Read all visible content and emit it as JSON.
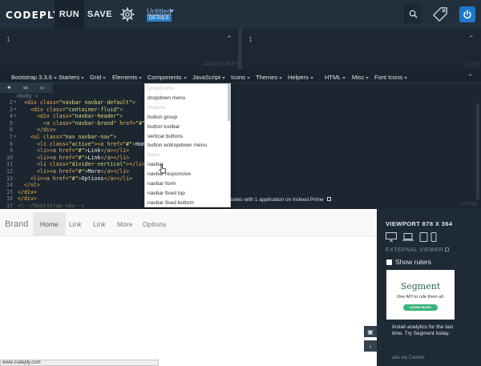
{
  "app": {
    "logo": "CODEPLY",
    "run_label": "RUN",
    "save_label": "SAVE",
    "project_title": "Untitled",
    "details_label": "DETAILS"
  },
  "editors": {
    "js": {
      "line_number": "1",
      "label": "JAVASCRIPT"
    },
    "css": {
      "line_number": "1",
      "label": "CSS"
    },
    "html": {
      "label": "HTML"
    }
  },
  "menubar": {
    "items": [
      {
        "label": "Bootstrap 3.3.6"
      },
      {
        "label": "Starters"
      },
      {
        "label": "Grid"
      },
      {
        "label": "Elements"
      },
      {
        "label": "Components"
      },
      {
        "label": "JavaScript"
      },
      {
        "label": "Icons"
      },
      {
        "label": "Themes"
      },
      {
        "label": "Helpers"
      },
      {
        "label": "HTML"
      },
      {
        "label": "Misc"
      },
      {
        "label": "Font Icons"
      }
    ]
  },
  "code": {
    "body_tag": "<body >",
    "lines": [
      {
        "n": "2",
        "fold": "▾",
        "segments": [
          [
            "tag",
            "<div class="
          ],
          [
            "str",
            "\"navbar navbar-default\""
          ],
          [
            "tag",
            ">"
          ]
        ]
      },
      {
        "n": "3",
        "fold": "▾",
        "segments": [
          [
            "tag",
            "<div class="
          ],
          [
            "str",
            "\"container-fluid\""
          ],
          [
            "tag",
            ">"
          ]
        ]
      },
      {
        "n": "4",
        "fold": "▾",
        "segments": [
          [
            "tag",
            "<div class="
          ],
          [
            "str",
            "\"navbar-header\""
          ],
          [
            "tag",
            ">"
          ]
        ]
      },
      {
        "n": "5",
        "fold": "",
        "segments": [
          [
            "tag",
            "<a class="
          ],
          [
            "str",
            "\"navbar-brand\""
          ],
          [
            "tag",
            " href="
          ],
          [
            "str",
            "\"#\""
          ],
          [
            "tag",
            ">"
          ],
          [
            "txt",
            "Bra"
          ]
        ]
      },
      {
        "n": "6",
        "fold": "",
        "segments": [
          [
            "tag",
            "</div>"
          ]
        ]
      },
      {
        "n": "7",
        "fold": "▾",
        "segments": [
          [
            "tag",
            "<ul class="
          ],
          [
            "str",
            "\"nav navbar-nav\""
          ],
          [
            "tag",
            ">"
          ]
        ]
      },
      {
        "n": "8",
        "fold": "",
        "segments": [
          [
            "tag",
            "<li class="
          ],
          [
            "str",
            "\"active\""
          ],
          [
            "tag",
            "><a href="
          ],
          [
            "str",
            "\"#\""
          ],
          [
            "tag",
            ">"
          ],
          [
            "txt",
            "Hom"
          ]
        ]
      },
      {
        "n": "9",
        "fold": "",
        "segments": [
          [
            "tag",
            "<li><a href="
          ],
          [
            "str",
            "\"#\""
          ],
          [
            "tag",
            ">"
          ],
          [
            "txt",
            "Link"
          ],
          [
            "tag",
            "</a></li>"
          ]
        ]
      },
      {
        "n": "10",
        "fold": "",
        "segments": [
          [
            "tag",
            "<li><a href="
          ],
          [
            "str",
            "\"#\""
          ],
          [
            "tag",
            ">"
          ],
          [
            "txt",
            "Link"
          ],
          [
            "tag",
            "</a></li>"
          ]
        ]
      },
      {
        "n": "11",
        "fold": "",
        "segments": [
          [
            "tag",
            "<li class="
          ],
          [
            "str",
            "\"divider-vertical\""
          ],
          [
            "tag",
            "></li>"
          ]
        ]
      },
      {
        "n": "12",
        "fold": "",
        "segments": [
          [
            "tag",
            "<li><a href="
          ],
          [
            "str",
            "\"#\""
          ],
          [
            "tag",
            ">"
          ],
          [
            "txt",
            "More"
          ],
          [
            "tag",
            "</a></li>"
          ]
        ]
      },
      {
        "n": "13",
        "fold": "",
        "segments": [
          [
            "tag",
            "<li><a href="
          ],
          [
            "str",
            "\"#\""
          ],
          [
            "tag",
            ">"
          ],
          [
            "txt",
            "Options"
          ],
          [
            "tag",
            "</a></li>"
          ]
        ]
      },
      {
        "n": "14",
        "fold": "",
        "segments": [
          [
            "tag",
            "</ul>"
          ]
        ]
      },
      {
        "n": "15",
        "fold": "",
        "segments": [
          [
            "tag",
            "</div>"
          ]
        ]
      },
      {
        "n": "16",
        "fold": "",
        "segments": [
          [
            "tag",
            "</div>"
          ]
        ]
      },
      {
        "n": "17",
        "fold": "",
        "segments": [
          [
            "cmt",
            "<!--/bootstrap-nav-->"
          ]
        ]
      }
    ]
  },
  "editor_ad": "anies with 1 application on Indeed Prime",
  "dropdown": {
    "rows": [
      {
        "label": "Dropdowns",
        "header": true
      },
      {
        "label": "dropdown menu",
        "header": false
      },
      {
        "label": "Buttons",
        "header": true
      },
      {
        "label": "button group",
        "header": false
      },
      {
        "label": "button toolbar",
        "header": false
      },
      {
        "label": "vertical buttons",
        "header": false
      },
      {
        "label": "button w/dropdown menu",
        "header": false
      },
      {
        "label": "Navs",
        "header": true
      },
      {
        "label": "navbar",
        "header": false
      },
      {
        "label": "navbar responsive",
        "header": false
      },
      {
        "label": "navbar form",
        "header": false
      },
      {
        "label": "navbar fixed top",
        "header": false
      },
      {
        "label": "navbar fixed bottom",
        "header": false
      }
    ]
  },
  "preview": {
    "brand": "Brand",
    "nav": [
      "Home",
      "Link",
      "Link",
      "More",
      "Options"
    ],
    "active_index": 0,
    "status_url": "www.codeply.com"
  },
  "viewport": {
    "title": "VIEWPORT 878 X 364",
    "external_viewer": "EXTERNAL VIEWER",
    "show_rulers": "Show rulers",
    "devices": [
      "desktop-icon",
      "laptop-icon",
      "tablet-icon",
      "phone-icon"
    ]
  },
  "ad": {
    "brand": "Segment",
    "tagline": "One API to rule them all.",
    "button": "LEARN MORE",
    "description": "Install analytics for the last time. Try Segment today.",
    "via": "ads via Carbon"
  },
  "colors": {
    "topbar": "#22303d",
    "editor_bg": "#1b2630",
    "accent_blue": "#1e76c7",
    "segment_green": "#3ab57a"
  }
}
